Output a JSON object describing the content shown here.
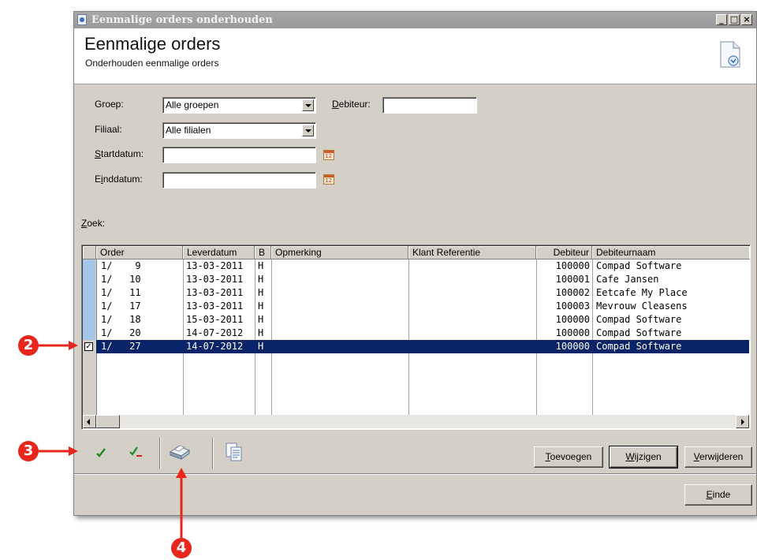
{
  "window": {
    "title": "Eenmalige orders onderhouden",
    "min": "_",
    "max": "□",
    "close": "×"
  },
  "header": {
    "title": "Eenmalige orders",
    "subtitle": "Onderhouden eenmalige orders"
  },
  "filters": {
    "groep_label": "Groep:",
    "groep_value": "Alle groepen",
    "filiaal_label": "Filiaal:",
    "filiaal_value": "Alle filialen",
    "startdatum_label_u": "S",
    "startdatum_label_rest": "tartdatum:",
    "einddatum_label_a": "E",
    "einddatum_label_u": "i",
    "einddatum_label_rest": "nddatum:",
    "debiteur_label_u": "D",
    "debiteur_label_rest": "ebiteur:",
    "startdatum_value": "",
    "einddatum_value": "",
    "debiteur_value": ""
  },
  "search": {
    "label_u": "Z",
    "label_rest": "oek:"
  },
  "grid": {
    "columns": [
      "Order",
      "Leverdatum",
      "B",
      "Opmerking",
      "Klant Referentie",
      "Debiteur",
      "Debiteurnaam"
    ],
    "rows": [
      {
        "order": "1/    9",
        "leverdatum": "13-03-2011",
        "b": "H",
        "opmerking": "",
        "klant_ref": "",
        "debiteur": "100000",
        "naam": "Compad Software"
      },
      {
        "order": "1/   10",
        "leverdatum": "13-03-2011",
        "b": "H",
        "opmerking": "",
        "klant_ref": "",
        "debiteur": "100001",
        "naam": "Cafe Jansen"
      },
      {
        "order": "1/   11",
        "leverdatum": "13-03-2011",
        "b": "H",
        "opmerking": "",
        "klant_ref": "",
        "debiteur": "100002",
        "naam": "Eetcafe My Place"
      },
      {
        "order": "1/   17",
        "leverdatum": "13-03-2011",
        "b": "H",
        "opmerking": "",
        "klant_ref": "",
        "debiteur": "100003",
        "naam": "Mevrouw Cleasens"
      },
      {
        "order": "1/   18",
        "leverdatum": "15-03-2011",
        "b": "H",
        "opmerking": "",
        "klant_ref": "",
        "debiteur": "100000",
        "naam": "Compad Software"
      },
      {
        "order": "1/   20",
        "leverdatum": "14-07-2012",
        "b": "H",
        "opmerking": "",
        "klant_ref": "",
        "debiteur": "100000",
        "naam": "Compad Software"
      },
      {
        "order": "1/   27",
        "leverdatum": "14-07-2012",
        "b": "H",
        "opmerking": "",
        "klant_ref": "",
        "debiteur": "100000",
        "naam": "Compad Software",
        "selected": true,
        "checked": true
      }
    ]
  },
  "buttons": {
    "toevoegen_u": "T",
    "toevoegen_rest": "oevoegen",
    "wijzigen_u": "W",
    "wijzigen_rest": "ijzigen",
    "verwijderen_u": "V",
    "verwijderen_rest": "erwijderen",
    "einde_u": "E",
    "einde_rest": "inde"
  },
  "callouts": [
    "2",
    "3",
    "4"
  ],
  "colors": {
    "selection": "#0a246a",
    "row_marker": "#a4c6e8",
    "callout": "#e8261b"
  }
}
